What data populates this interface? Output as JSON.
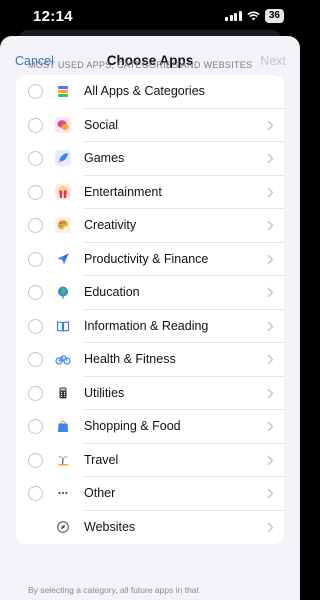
{
  "status": {
    "time": "12:14",
    "battery": "36"
  },
  "nav": {
    "cancel_label": "Cancel",
    "title": "Choose Apps",
    "next_label": "Next"
  },
  "section_header": "Most used apps, categories and websites",
  "items": [
    {
      "label": "All Apps & Categories",
      "icon": "stack-icon",
      "icon_color": "#5b6ef5"
    },
    {
      "label": "Social",
      "icon": "chat-bubbles-icon",
      "icon_color": "#e0479a"
    },
    {
      "label": "Games",
      "icon": "rocket-icon",
      "icon_color": "#3b82f6"
    },
    {
      "label": "Entertainment",
      "icon": "popcorn-icon",
      "icon_color": "#e53935"
    },
    {
      "label": "Creativity",
      "icon": "palette-icon",
      "icon_color": "#f2a33a"
    },
    {
      "label": "Productivity & Finance",
      "icon": "paper-plane-icon",
      "icon_color": "#3b82f6"
    },
    {
      "label": "Education",
      "icon": "globe-icon",
      "icon_color": "#3aa35b"
    },
    {
      "label": "Information & Reading",
      "icon": "book-icon",
      "icon_color": "#3b82f6"
    },
    {
      "label": "Health & Fitness",
      "icon": "bicycle-icon",
      "icon_color": "#3b82f6"
    },
    {
      "label": "Utilities",
      "icon": "calculator-icon",
      "icon_color": "#555555"
    },
    {
      "label": "Shopping & Food",
      "icon": "shopping-bag-icon",
      "icon_color": "#3b82f6"
    },
    {
      "label": "Travel",
      "icon": "palm-tree-icon",
      "icon_color": "#f2a33a"
    },
    {
      "label": "Other",
      "icon": "ellipsis-icon",
      "icon_color": "#555555"
    },
    {
      "label": "Websites",
      "icon": "compass-icon",
      "icon_color": "#555555"
    }
  ],
  "footer_text": "By selecting a category, all future apps in that"
}
